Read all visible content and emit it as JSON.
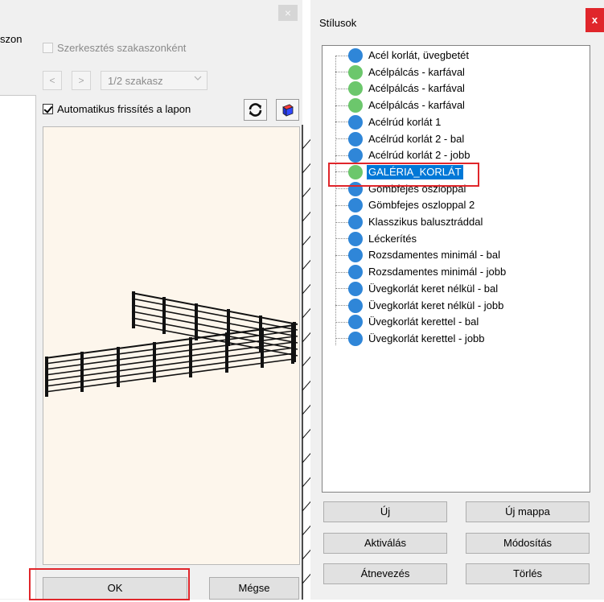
{
  "left_dialog": {
    "truncated_label": "szon",
    "edit_by_sections_label": "Szerkesztés szakaszonként",
    "prev_label": "<",
    "next_label": ">",
    "section_value": "1/2 szakasz",
    "auto_refresh_label": "Automatikus frissítés a lapon",
    "ok_label": "OK",
    "cancel_label": "Mégse",
    "close_glyph": "×"
  },
  "styles_dialog": {
    "title": "Stílusok",
    "close_glyph": "x",
    "items": [
      {
        "label": "Acél korlát, üvegbetét",
        "color": "#2f86d8"
      },
      {
        "label": "Acélpálcás - karfával",
        "color": "#6cc76c"
      },
      {
        "label": "Acélpálcás - karfával",
        "color": "#6cc76c"
      },
      {
        "label": "Acélpálcás - karfával",
        "color": "#6cc76c"
      },
      {
        "label": "Acélrúd korlát 1",
        "color": "#2f86d8"
      },
      {
        "label": "Acélrúd korlát 2 - bal",
        "color": "#2f86d8"
      },
      {
        "label": "Acélrúd korlát 2 - jobb",
        "color": "#2f86d8"
      },
      {
        "label": "GALÉRIA_KORLÁT",
        "color": "#6cc76c",
        "selected": true
      },
      {
        "label": "Gömbfejes oszloppal",
        "color": "#2f86d8"
      },
      {
        "label": "Gömbfejes oszloppal 2",
        "color": "#2f86d8"
      },
      {
        "label": "Klasszikus balusztráddal",
        "color": "#2f86d8"
      },
      {
        "label": "Léckerítés",
        "color": "#2f86d8"
      },
      {
        "label": "Rozsdamentes minimál - bal",
        "color": "#2f86d8"
      },
      {
        "label": "Rozsdamentes minimál - jobb",
        "color": "#2f86d8"
      },
      {
        "label": "Üvegkorlát keret nélkül - bal",
        "color": "#2f86d8"
      },
      {
        "label": "Üvegkorlát keret nélkül - jobb",
        "color": "#2f86d8"
      },
      {
        "label": "Üvegkorlát kerettel - bal",
        "color": "#2f86d8"
      },
      {
        "label": "Üvegkorlát kerettel - jobb",
        "color": "#2f86d8"
      }
    ],
    "buttons": {
      "new": "Új",
      "new_folder": "Új mappa",
      "activate": "Aktiválás",
      "modify": "Módosítás",
      "rename": "Átnevezés",
      "delete": "Törlés"
    }
  },
  "colors": {
    "highlight_red": "#e0262b",
    "selection_blue": "#0078d7",
    "preview_bg": "#fdf6ec"
  }
}
